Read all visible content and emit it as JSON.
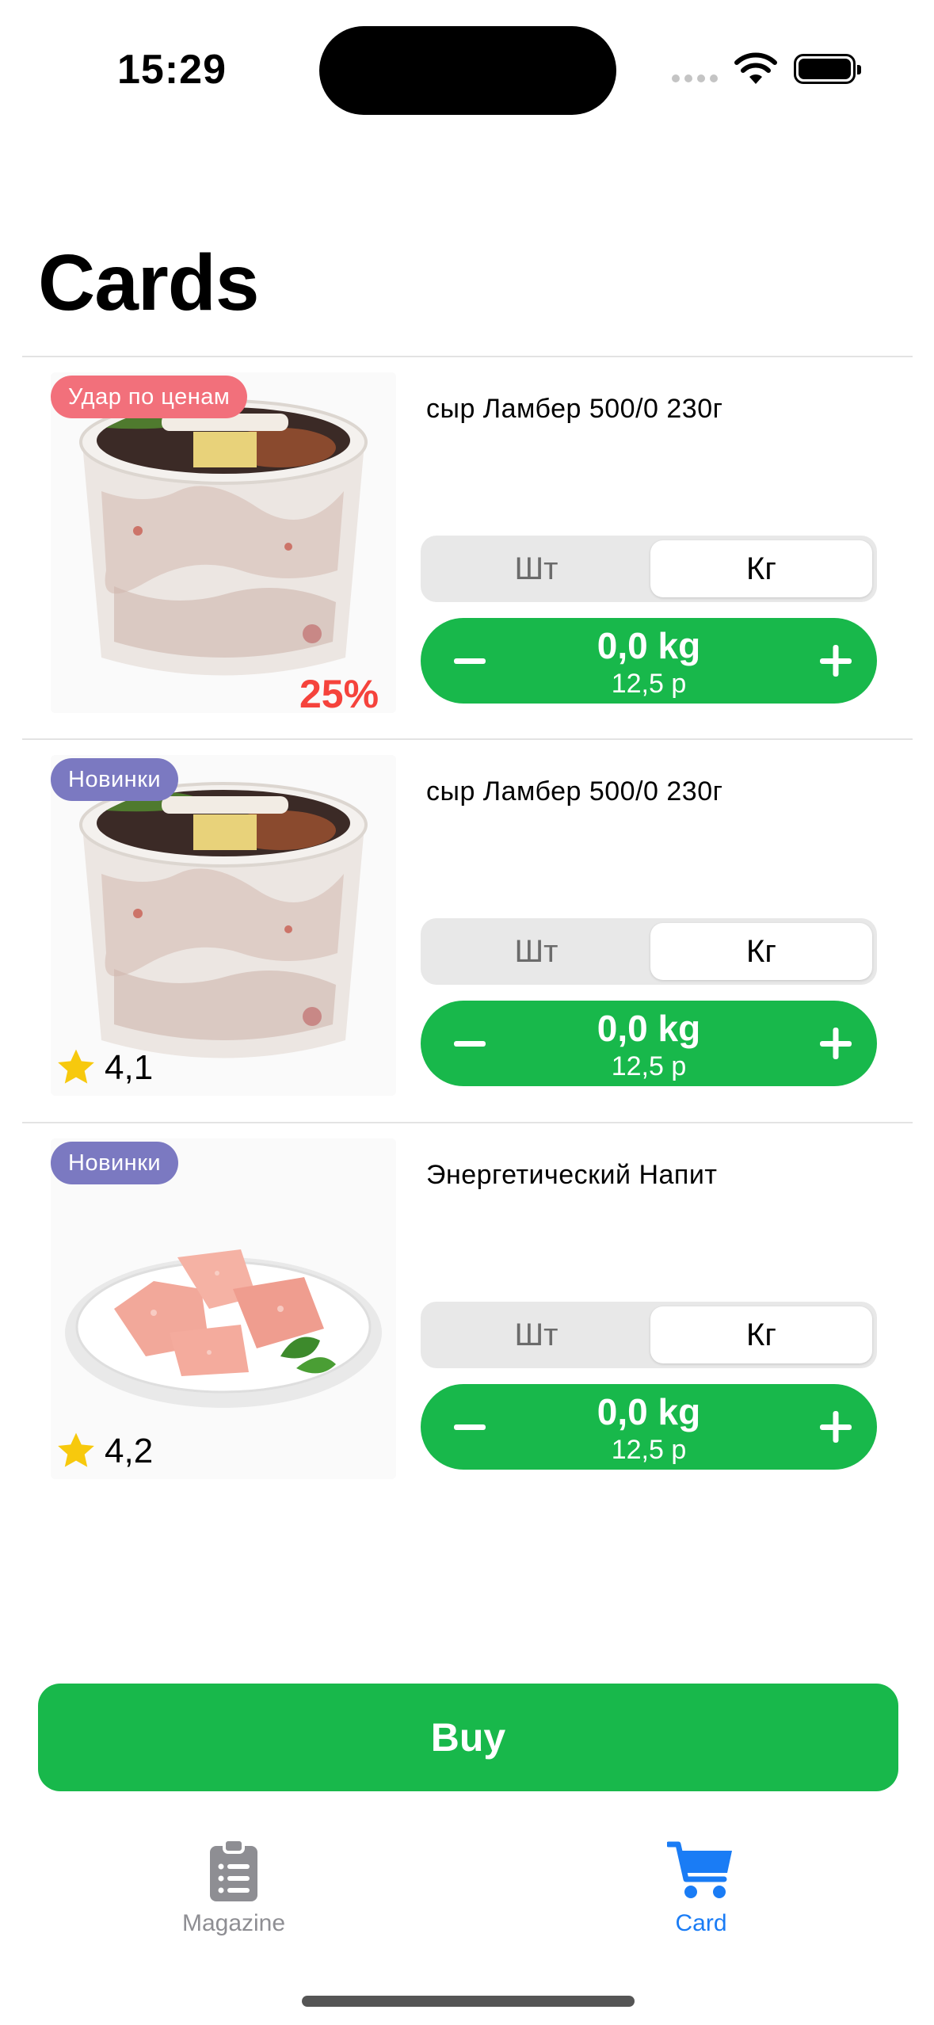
{
  "status_bar": {
    "time": "15:29"
  },
  "page": {
    "title": "Cards"
  },
  "cards": [
    {
      "badge": "Удар по ценам",
      "badge_color": "#f2707b",
      "discount": "25%",
      "name": "сыр Ламбер 500/0 230г",
      "unit_left": "Шт",
      "unit_right": "Кг",
      "selected_unit": "Кг",
      "quantity": "0,0 kg",
      "price": "12,5 р",
      "image": "pork-salad-tub"
    },
    {
      "badge": "Новинки",
      "badge_color": "#7b79c1",
      "rating": "4,1",
      "name": "сыр Ламбер 500/0 230г",
      "unit_left": "Шт",
      "unit_right": "Кг",
      "selected_unit": "Кг",
      "quantity": "0,0 kg",
      "price": "12,5 р",
      "image": "pork-salad-tub"
    },
    {
      "badge": "Новинки",
      "badge_color": "#7b79c1",
      "rating": "4,2",
      "name": "Энергетический Напит",
      "unit_left": "Шт",
      "unit_right": "Кг",
      "selected_unit": "Кг",
      "quantity": "0,0 kg",
      "price": "12,5 р",
      "image": "meat-plate"
    }
  ],
  "buy_button": {
    "label": "Buy",
    "color": "#18b84b"
  },
  "tab_bar": {
    "tabs": [
      {
        "label": "Magazine",
        "icon": "clipboard-list-icon",
        "active": false
      },
      {
        "label": "Card",
        "icon": "cart-icon",
        "active": true
      }
    ],
    "active_color": "#1a7cf5",
    "inactive_color": "#8e8e93"
  }
}
